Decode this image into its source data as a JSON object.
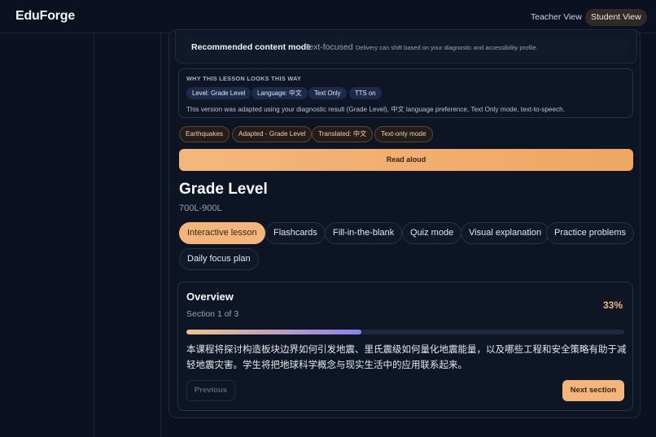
{
  "header": {
    "logo": "EduForge",
    "teacher_view": "Teacher View",
    "student_view": "Student View"
  },
  "mode": {
    "title": "Recommended content mode",
    "value": "Text-focused",
    "note": "Delivery can shift based on your diagnostic and accessibility profile."
  },
  "why": {
    "title": "WHY THIS LESSON LOOKS THIS WAY",
    "tags": [
      "Level: Grade Level",
      "Language: 中文",
      "Text Only",
      "TTS on"
    ],
    "text": "This version was adapted using your diagnostic result (Grade Level), 中文 language preference, Text Only mode, text-to-speech."
  },
  "chips": [
    "Earthquakes",
    "Adapted - Grade Level",
    "Translated: 中文",
    "Text-only mode"
  ],
  "read_aloud": "Read aloud",
  "lesson": {
    "title": "Grade Level",
    "range": "700L-900L"
  },
  "tabs": [
    "Interactive lesson",
    "Flashcards",
    "Fill-in-the-blank",
    "Quiz mode",
    "Visual explanation",
    "Practice problems",
    "Daily focus plan"
  ],
  "overview": {
    "title": "Overview",
    "section": "Section 1 of 3",
    "percent_label": "33%",
    "progress": 0.4,
    "text": "本课程将探讨构造板块边界如何引发地震、里氏震级如何量化地震能量，以及哪些工程和安全策略有助于减轻地震灾害。学生将把地球科学概念与现实生活中的应用联系起来。",
    "previous": "Previous",
    "next": "Next section"
  },
  "colors": {
    "accent": "#f3b57c",
    "background": "#0b1120",
    "progress_end": "#8b7ff0"
  }
}
